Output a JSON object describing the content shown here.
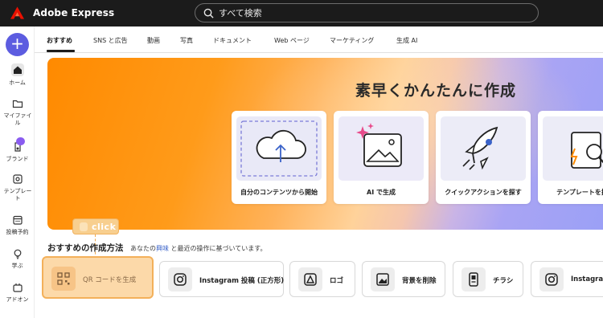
{
  "app": {
    "title": "Adobe Express"
  },
  "search": {
    "placeholder": "すべて検索",
    "value": ""
  },
  "sidebar": {
    "create_label": "+",
    "items": [
      {
        "label": "ホーム",
        "icon": "home-icon"
      },
      {
        "label": "マイファイル",
        "icon": "folder-icon"
      },
      {
        "label": "ブランド",
        "icon": "brand-icon"
      },
      {
        "label": "テンプレート",
        "icon": "template-icon"
      },
      {
        "label": "投稿予約",
        "icon": "calendar-icon"
      },
      {
        "label": "学ぶ",
        "icon": "lightbulb-icon"
      },
      {
        "label": "アドオン",
        "icon": "addon-icon"
      }
    ]
  },
  "tabs": [
    "おすすめ",
    "SNS と広告",
    "動画",
    "写真",
    "ドキュメント",
    "Web ページ",
    "マーケティング",
    "生成 AI"
  ],
  "hero": {
    "title": "素早くかんたんに作成",
    "cards": [
      {
        "label": "自分のコンテンツから開始",
        "icon": "upload-cloud-icon"
      },
      {
        "label": "AI で生成",
        "icon": "ai-image-icon"
      },
      {
        "label": "クイックアクションを探す",
        "icon": "rocket-icon"
      },
      {
        "label": "テンプレートを探す",
        "icon": "template-search-icon"
      }
    ]
  },
  "annotation": {
    "click_label": "click"
  },
  "recommended": {
    "title": "おすすめの作成方法",
    "subtitle_pre": "あなたの",
    "subtitle_hl": "興味",
    "subtitle_post": "と最近の操作に基づいています。",
    "actions": [
      {
        "label": "QR コードを生成",
        "icon": "qr-code-icon"
      },
      {
        "label": "Instagram 投稿 (正方形)",
        "icon": "instagram-icon"
      },
      {
        "label": "ロゴ",
        "icon": "logo-icon"
      },
      {
        "label": "背景を削除",
        "icon": "remove-background-icon"
      },
      {
        "label": "チラシ",
        "icon": "flyer-icon"
      },
      {
        "label": "Instagram",
        "icon": "instagram-icon"
      }
    ]
  },
  "colors": {
    "accent": "#5c5ce0",
    "topbar": "#1b1b1b",
    "highlight": "#fcd9a9",
    "highlight_border": "#f3b05a"
  }
}
